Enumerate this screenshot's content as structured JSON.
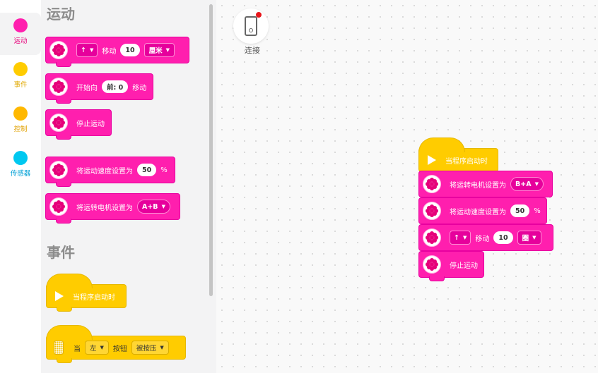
{
  "categories": [
    {
      "label": "运动",
      "color": "#ff1fae",
      "label_color": "#e6007a"
    },
    {
      "label": "事件",
      "color": "#ffcc00",
      "label_color": "#e0a800"
    },
    {
      "label": "控制",
      "color": "#ffb800",
      "label_color": "#e0a000"
    },
    {
      "label": "传感器",
      "color": "#00c8f0",
      "label_color": "#00a0d6"
    }
  ],
  "flyout": {
    "motion_title": "运动",
    "events_title": "事件",
    "move_block": {
      "arrow": "↑",
      "move": "移动",
      "value": "10",
      "unit": "厘米"
    },
    "start_block": {
      "text": "开始向",
      "direction": "前: 0",
      "move": "移动"
    },
    "stop_block": {
      "text": "停止运动"
    },
    "speed_block": {
      "text": "将运动速度设置为",
      "value": "50",
      "unit": "%"
    },
    "motors_block": {
      "text": "将运转电机设置为",
      "value": "A+B"
    },
    "when_start_block": {
      "text": "当程序启动时"
    },
    "button_block": {
      "when": "当",
      "side": "左",
      "button": "按钮",
      "state": "被按压"
    }
  },
  "connect": {
    "label": "连接"
  },
  "workspace": {
    "hat": {
      "text": "当程序启动时"
    },
    "motors": {
      "text": "将运转电机设置为",
      "value": "B+A"
    },
    "speed": {
      "text": "将运动速度设置为",
      "value": "50",
      "unit": "%"
    },
    "move": {
      "arrow": "↑",
      "move": "移动",
      "value": "10",
      "unit": "圈"
    },
    "stop": {
      "text": "停止运动"
    }
  },
  "colors": {
    "motion": "#ff1fae",
    "events": "#ffcc00",
    "sensors": "#00c8f0"
  }
}
